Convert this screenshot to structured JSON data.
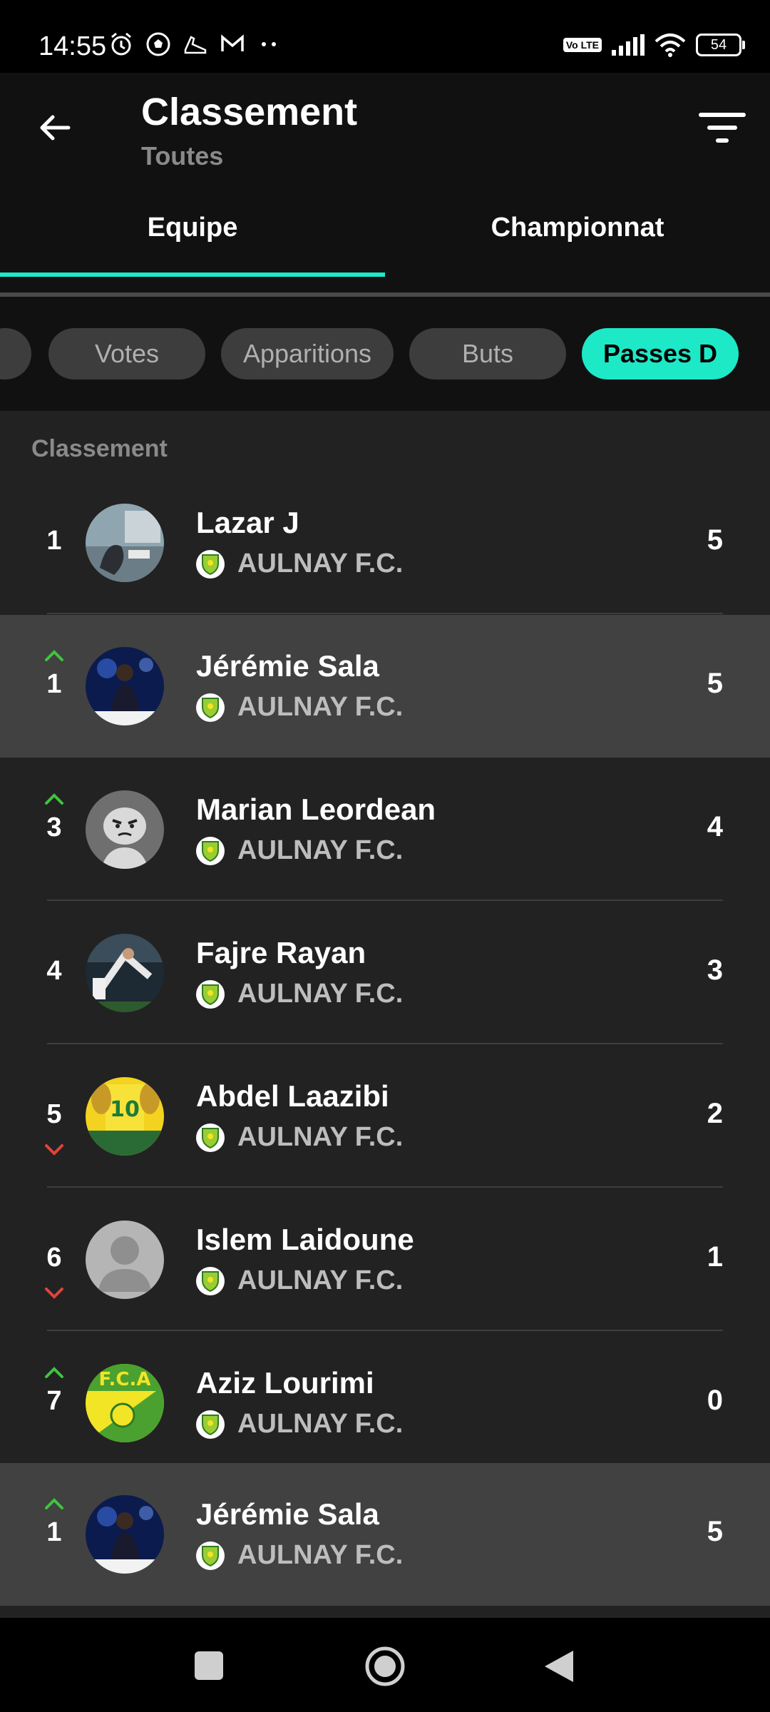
{
  "status_bar": {
    "time": "14:55",
    "left_icons": [
      "alarm-icon",
      "soccer-ball-icon",
      "shoe-icon",
      "gmail-icon",
      "more-dots-icon"
    ],
    "network_label": "Vo LTE",
    "battery": "54"
  },
  "app_bar": {
    "title": "Classement",
    "subtitle": "Toutes"
  },
  "tabs": [
    {
      "label": "Equipe",
      "active": true
    },
    {
      "label": "Championnat",
      "active": false
    }
  ],
  "chips": [
    {
      "label": "",
      "active": false
    },
    {
      "label": "Votes",
      "active": false
    },
    {
      "label": "Apparitions",
      "active": false
    },
    {
      "label": "Buts",
      "active": false
    },
    {
      "label": "Passes D",
      "active": true
    }
  ],
  "colors": {
    "accent": "#1de9c7",
    "up": "#3ec53e",
    "down": "#e0443a",
    "club_logo": "#9acd32"
  },
  "list": {
    "section_label": "Classement",
    "rows": [
      {
        "rank": "1",
        "trend": "none",
        "name": "Lazar J",
        "club": "AULNAY F.C.",
        "value": "5",
        "avatar": "photo-room",
        "highlight": false
      },
      {
        "rank": "1",
        "trend": "up",
        "name": "Jérémie Sala",
        "club": "AULNAY F.C.",
        "value": "5",
        "avatar": "photo-player-blue",
        "highlight": true
      },
      {
        "rank": "3",
        "trend": "up",
        "name": "Marian Leordean",
        "club": "AULNAY F.C.",
        "value": "4",
        "avatar": "cartoon-face",
        "highlight": false
      },
      {
        "rank": "4",
        "trend": "none",
        "name": "Fajre Rayan",
        "club": "AULNAY F.C.",
        "value": "3",
        "avatar": "photo-stadium",
        "highlight": false
      },
      {
        "rank": "5",
        "trend": "down",
        "name": "Abdel Laazibi",
        "club": "AULNAY F.C.",
        "value": "2",
        "avatar": "photo-jersey",
        "highlight": false
      },
      {
        "rank": "6",
        "trend": "down",
        "name": "Islem Laidoune",
        "club": "AULNAY F.C.",
        "value": "1",
        "avatar": "default-avatar",
        "highlight": false
      },
      {
        "rank": "7",
        "trend": "up",
        "name": "Aziz Lourimi",
        "club": "AULNAY F.C.",
        "value": "0",
        "avatar": "fca-logo",
        "highlight": false
      },
      {
        "rank": "1",
        "trend": "up",
        "name": "Jérémie Sala",
        "club": "AULNAY F.C.",
        "value": "5",
        "avatar": "photo-player-blue",
        "highlight": true
      }
    ]
  },
  "avatar_texts": {
    "fca": "F.C.A"
  },
  "nav_bar": [
    "recents-button",
    "home-button",
    "back-button"
  ]
}
